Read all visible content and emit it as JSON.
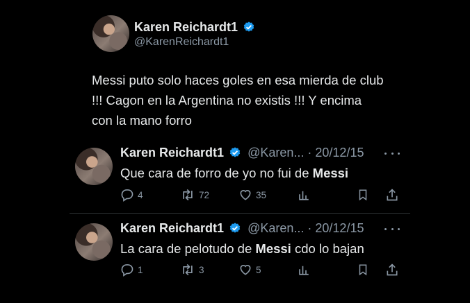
{
  "main_tweet": {
    "name": "Karen Reichardt1",
    "handle": "@KarenReichardt1",
    "text": "Messi puto solo haces goles en esa mierda de club !!! Cagon  en la Argentina no existis !!! Y encima con la mano forro"
  },
  "replies": [
    {
      "name": "Karen Reichardt1",
      "meta": "@Karen... · 20/12/15",
      "text_before": "Que cara de forro de yo no fui de ",
      "text_bold": "Messi",
      "text_after": "",
      "replies_count": "4",
      "retweets_count": "72",
      "likes_count": "35"
    },
    {
      "name": "Karen Reichardt1",
      "meta": "@Karen... · 20/12/15",
      "text_before": "La cara de pelotudo de ",
      "text_bold": "Messi",
      "text_after": " cdo lo bajan",
      "replies_count": "1",
      "retweets_count": "3",
      "likes_count": "5"
    }
  ],
  "colors": {
    "background": "#000000",
    "text": "#e7e9ea",
    "muted": "#8b98a5",
    "verified": "#1d9bf0"
  },
  "icons": [
    "verified-badge-icon",
    "more-icon",
    "reply-icon",
    "retweet-icon",
    "like-icon",
    "views-icon",
    "bookmark-icon",
    "share-icon"
  ]
}
